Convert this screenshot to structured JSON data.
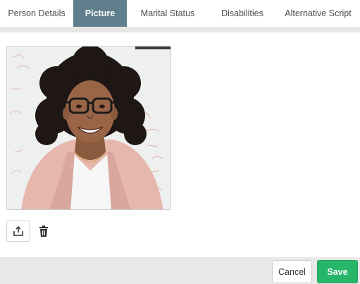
{
  "tabs": [
    {
      "label": "Person Details",
      "active": false
    },
    {
      "label": "Picture",
      "active": true
    },
    {
      "label": "Marital Status",
      "active": false
    },
    {
      "label": "Disabilities",
      "active": false
    },
    {
      "label": "Alternative Script",
      "active": false
    }
  ],
  "picture": {
    "upload_icon": "upload-icon",
    "delete_icon": "trash-icon"
  },
  "footer": {
    "cancel_label": "Cancel",
    "save_label": "Save"
  },
  "colors": {
    "active_tab": "#5f7f8c",
    "save_button": "#27b56a"
  }
}
